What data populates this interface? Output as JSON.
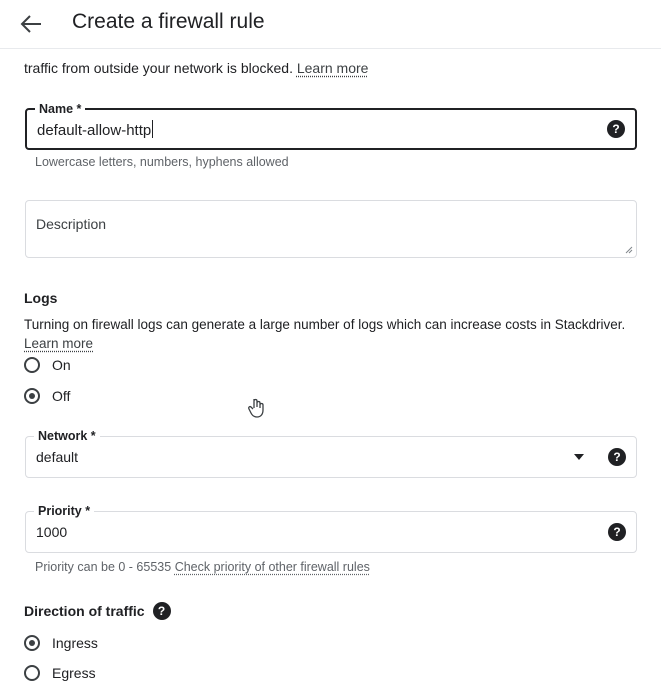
{
  "header": {
    "title": "Create a firewall rule"
  },
  "intro": {
    "text": "traffic from outside your network is blocked.",
    "link": "Learn more"
  },
  "name_field": {
    "label": "Name *",
    "value": "default-allow-http",
    "hint": "Lowercase letters, numbers, hyphens allowed"
  },
  "description_field": {
    "placeholder": "Description"
  },
  "logs": {
    "title": "Logs",
    "text": "Turning on firewall logs can generate a large number of logs which can increase costs in Stackdriver.",
    "link": "Learn more",
    "options": [
      {
        "label": "On",
        "checked": false
      },
      {
        "label": "Off",
        "checked": true
      }
    ]
  },
  "network_field": {
    "label": "Network *",
    "value": "default"
  },
  "priority_field": {
    "label": "Priority *",
    "value": "1000",
    "hint": "Priority can be 0 - 65535",
    "link": "Check priority of other firewall rules"
  },
  "direction": {
    "title": "Direction of traffic",
    "options": [
      {
        "label": "Ingress",
        "checked": true
      },
      {
        "label": "Egress",
        "checked": false
      }
    ]
  },
  "icons": {
    "back": "arrow-back-icon",
    "help": "help-circle-icon",
    "dropdown": "arrow-drop-down-icon",
    "help_glyph": "?"
  }
}
